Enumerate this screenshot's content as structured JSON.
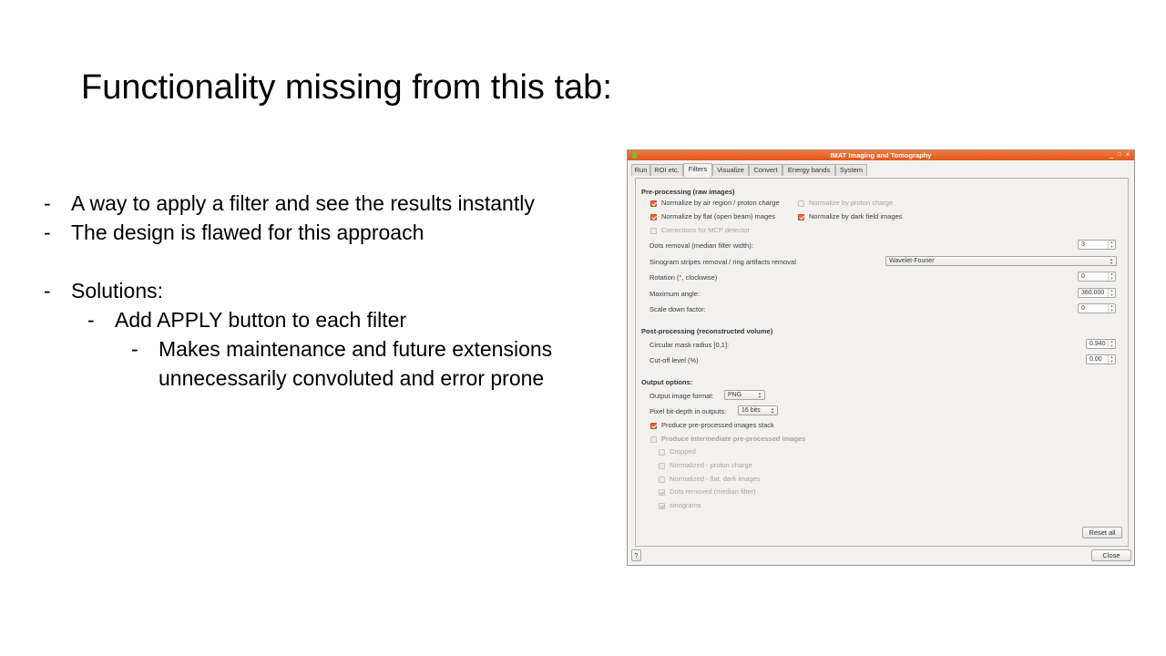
{
  "slide": {
    "title": "Functionality missing from this tab:",
    "bullets": [
      "A way to apply a filter and see the results instantly",
      "The design is flawed for this approach",
      "Solutions:",
      "Add APPLY button to each filter",
      "Makes maintenance and future extensions",
      "unnecessarily convoluted and error prone"
    ],
    "dash": "-"
  },
  "window": {
    "title": "IMAT Imaging and Tomography",
    "controls": {
      "minimize": "_",
      "maximize": "□",
      "close": "×"
    },
    "tabs": [
      "Run",
      "ROI etc.",
      "Filters",
      "Visualize",
      "Convert",
      "Energy bands",
      "System"
    ],
    "active_tab": "Filters",
    "preprocessing": {
      "heading": "Pre-processing (raw images)",
      "norm_air": "Normalize by air region / proton charge",
      "norm_proton": "Normalize by proton charge",
      "norm_flat": "Normalize by flat (open beam) mages",
      "norm_dark": "Normalize by dark field images",
      "mcp": "Corrections for MCP detector",
      "dots_label": "Dots removal (median filter width):",
      "dots_value": "3",
      "sino_label": "Sinogram stripes removal / ring artifacts removal",
      "sino_value": "Wavelet-Fourier",
      "rotation_label": "Rotation (°, clockwise)",
      "rotation_value": "0",
      "maxangle_label": "Maximum angle:",
      "maxangle_value": "360.000",
      "scale_label": "Scale down factor:",
      "scale_value": "0"
    },
    "postprocessing": {
      "heading": "Post-processing (reconstructed volume)",
      "mask_label": "Circular mask radius [0,1]:",
      "mask_value": "0.940",
      "cutoff_label": "Cut-off level (%)",
      "cutoff_value": "0.00"
    },
    "output": {
      "heading": "Output options:",
      "format_label": "Output image format:",
      "format_value": "PNG",
      "depth_label": "Pixel bit-depth in outputs:",
      "depth_value": "16 bits",
      "stack_label": "Produce pre-processed images stack",
      "intermediate_label": "Produce intermediate pre-processed images",
      "sub_cropped": "Cropped",
      "sub_proton": "Normalized - proton charge",
      "sub_flat": "Normalized - flat, dark images",
      "sub_dots": "Dots removed (median filter)",
      "sub_sino": "sinograms"
    },
    "reset_label": "Reset all",
    "help_label": "?",
    "close_label": "Close"
  }
}
